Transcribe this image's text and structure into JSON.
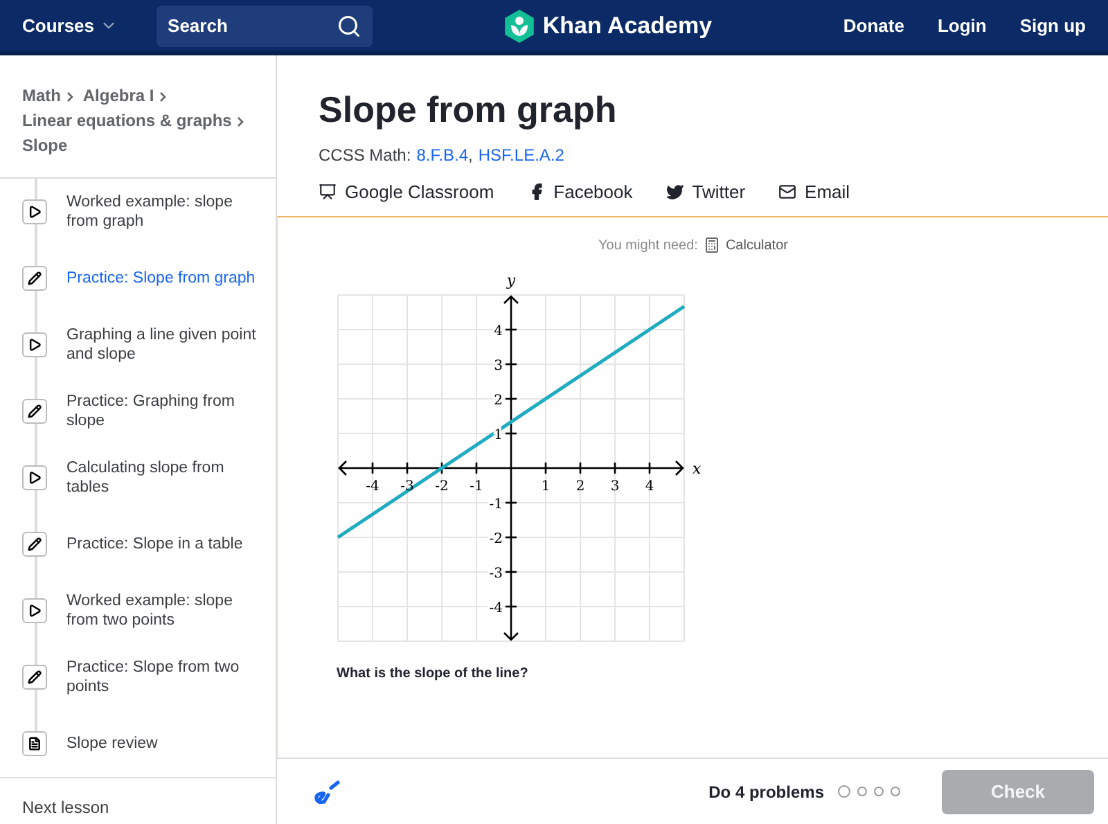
{
  "header": {
    "courses": "Courses",
    "search": {
      "placeholder": "Search"
    },
    "logo": "Khan Academy",
    "links": [
      "Donate",
      "Login",
      "Sign up"
    ]
  },
  "breadcrumb": [
    "Math",
    "Algebra I",
    "Linear equations & graphs",
    "Slope"
  ],
  "sidebar": {
    "items": [
      {
        "label": "Worked example: slope from graph",
        "kind": "video",
        "selected": false
      },
      {
        "label": "Practice: Slope from graph",
        "kind": "exercise",
        "selected": true
      },
      {
        "label": "Graphing a line given point and slope",
        "kind": "video",
        "selected": false
      },
      {
        "label": "Practice: Graphing from slope",
        "kind": "exercise",
        "selected": false
      },
      {
        "label": "Calculating slope from tables",
        "kind": "video",
        "selected": false
      },
      {
        "label": "Practice: Slope in a table",
        "kind": "exercise",
        "selected": false
      },
      {
        "label": "Worked example: slope from two points",
        "kind": "video",
        "selected": false
      },
      {
        "label": "Practice: Slope from two points",
        "kind": "exercise",
        "selected": false
      },
      {
        "label": "Slope review",
        "kind": "article",
        "selected": false
      }
    ],
    "next": "Next lesson"
  },
  "title": "Slope from graph",
  "standards": {
    "label": "CCSS Math:",
    "codes": [
      "8.F.B.4",
      "HSF.LE.A.2"
    ],
    "separator": ","
  },
  "share": [
    {
      "kind": "classroom",
      "label": "Google Classroom"
    },
    {
      "kind": "facebook",
      "label": "Facebook"
    },
    {
      "kind": "twitter",
      "label": "Twitter"
    },
    {
      "kind": "email",
      "label": "Email"
    }
  ],
  "exercise": {
    "need_label": "You might need:",
    "tool": "Calculator",
    "chart_data": {
      "type": "line",
      "xlabel": "x",
      "ylabel": "y",
      "x": [
        -5,
        5
      ],
      "grid": true,
      "series": [
        {
          "color": "#1fabc0",
          "values": [
            -2,
            4.67
          ]
        }
      ],
      "xlim": [
        -5,
        5
      ],
      "ylim": [
        -5,
        5
      ],
      "xticks": [
        -4,
        -3,
        -2,
        -1,
        1,
        2,
        3,
        4
      ],
      "yticks": [
        -4,
        -3,
        -2,
        -1,
        1,
        2,
        3,
        4
      ]
    },
    "question": "What is the slope of the line?"
  },
  "footer": {
    "goal": "Do 4 problems",
    "dots": [
      {
        "selected": true
      },
      {
        "selected": false
      },
      {
        "selected": false
      },
      {
        "selected": false
      }
    ],
    "check": {
      "label": "Check",
      "disabled": true
    }
  }
}
